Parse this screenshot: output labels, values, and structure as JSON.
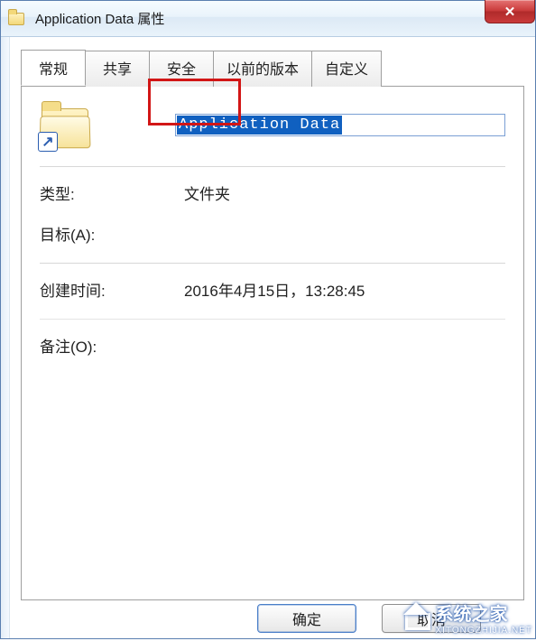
{
  "window": {
    "title": "Application Data 属性"
  },
  "tabs": [
    {
      "id": "general",
      "label": "常规",
      "active": true
    },
    {
      "id": "sharing",
      "label": "共享",
      "active": false
    },
    {
      "id": "security",
      "label": "安全",
      "active": false
    },
    {
      "id": "previous",
      "label": "以前的版本",
      "active": false
    },
    {
      "id": "custom",
      "label": "自定义",
      "active": false
    }
  ],
  "highlight_tab_index": 2,
  "general": {
    "name_value": "Application Data",
    "type_label": "类型:",
    "type_value": "文件夹",
    "target_label": "目标(A):",
    "target_value": "",
    "created_label": "创建时间:",
    "created_value": "2016年4月15日，13:28:45",
    "comment_label": "备注(O):",
    "comment_value": ""
  },
  "buttons": {
    "ok": "确定",
    "cancel": "取消"
  },
  "watermark": {
    "text": "系统之家",
    "sub": "XITONGZHIJIA.NET"
  },
  "icons": {
    "close": "✕",
    "shortcut_arrow": "↗"
  }
}
